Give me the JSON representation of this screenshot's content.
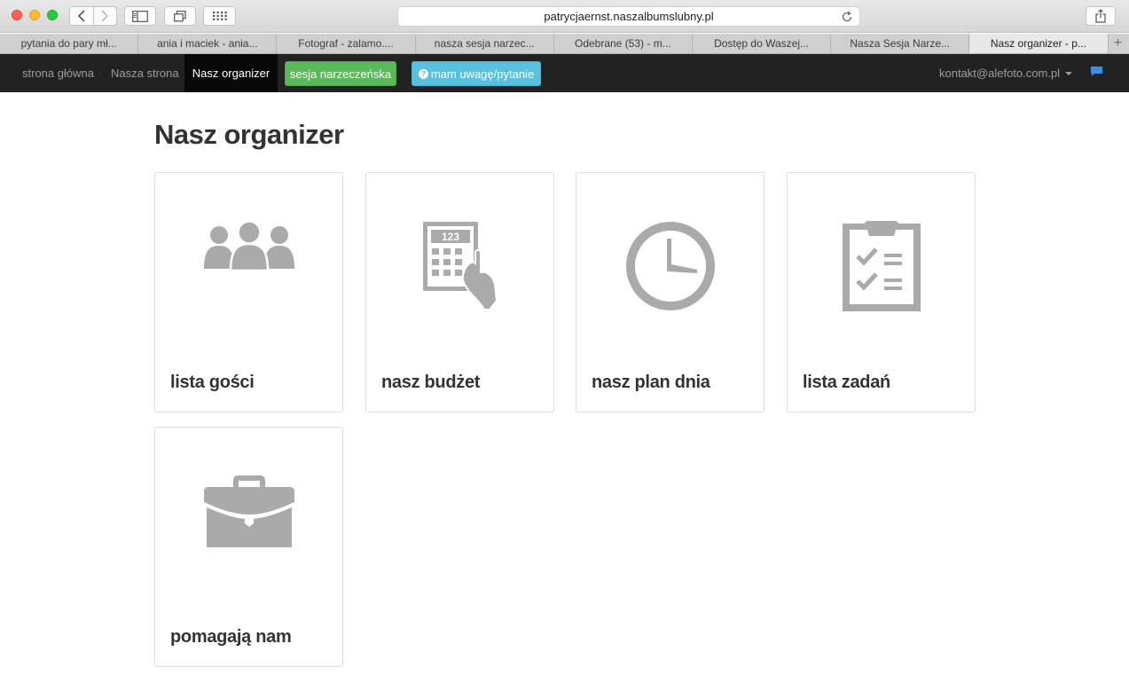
{
  "browser": {
    "url": "patrycjaernst.naszalbumslubny.pl",
    "tabs": [
      {
        "label": "pytania do pary mł..."
      },
      {
        "label": "ania i maciek - ania..."
      },
      {
        "label": "Fotograf - zalamo...."
      },
      {
        "label": "nasza sesja narzec..."
      },
      {
        "label": "Odebrane (53) - m..."
      },
      {
        "label": "Dostęp do Waszej..."
      },
      {
        "label": "Nasza Sesja Narze..."
      },
      {
        "label": "Nasz organizer - p..."
      }
    ],
    "add_tab": "+"
  },
  "navbar": {
    "home": "strona główna",
    "our_page": "Nasza strona",
    "organizer": "Nasz organizer",
    "engagement_session": "sesja narzeczeńska",
    "feedback_icon": "?",
    "feedback": "mam uwagę/pytanie",
    "account": "kontakt@alefoto.com.pl"
  },
  "page": {
    "title": "Nasz organizer",
    "cards": [
      {
        "label": "lista gości",
        "icon": "guests-icon"
      },
      {
        "label": "nasz budżet",
        "icon": "calculator-icon",
        "icon_text": "123"
      },
      {
        "label": "nasz plan dnia",
        "icon": "clock-icon"
      },
      {
        "label": "lista zadań",
        "icon": "clipboard-checklist-icon"
      },
      {
        "label": "pomagają nam",
        "icon": "briefcase-icon"
      }
    ]
  },
  "colors": {
    "navbar_bg": "#222222",
    "nav_active_bg": "#080808",
    "btn_green": "#5cb85c",
    "btn_blue": "#5bc0de",
    "icon_gray": "#aaaaaa",
    "chat_blue": "#3a8ee6"
  }
}
